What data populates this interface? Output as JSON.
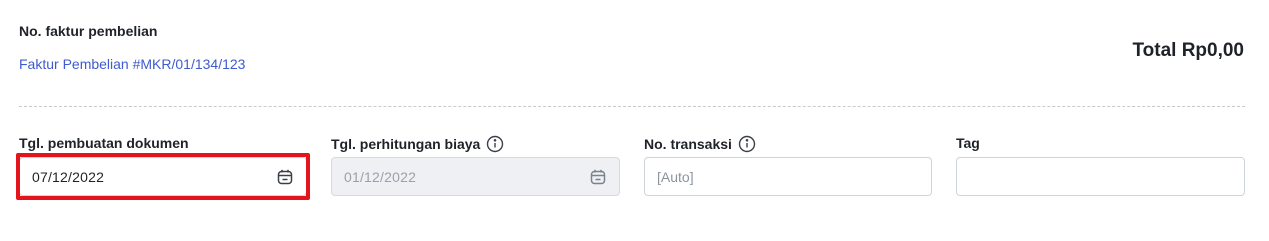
{
  "header": {
    "invoice_label": "No. faktur pembelian",
    "invoice_link": "Faktur Pembelian #MKR/01/134/123",
    "total": "Total Rp0,00"
  },
  "fields": {
    "doc_date": {
      "label": "Tgl. pembuatan dokumen",
      "value": "07/12/2022",
      "icon": "calendar-icon"
    },
    "cost_date": {
      "label": "Tgl. perhitungan biaya",
      "value": "01/12/2022",
      "icon": "calendar-icon",
      "info_icon": "info-icon",
      "disabled": true
    },
    "transaction_no": {
      "label": "No. transaksi",
      "placeholder": "[Auto]",
      "info_icon": "info-icon"
    },
    "tag": {
      "label": "Tag",
      "value": ""
    }
  },
  "colors": {
    "link": "#3f5bcf",
    "highlight": "#e3141c",
    "disabled_bg": "#eef0f3"
  }
}
